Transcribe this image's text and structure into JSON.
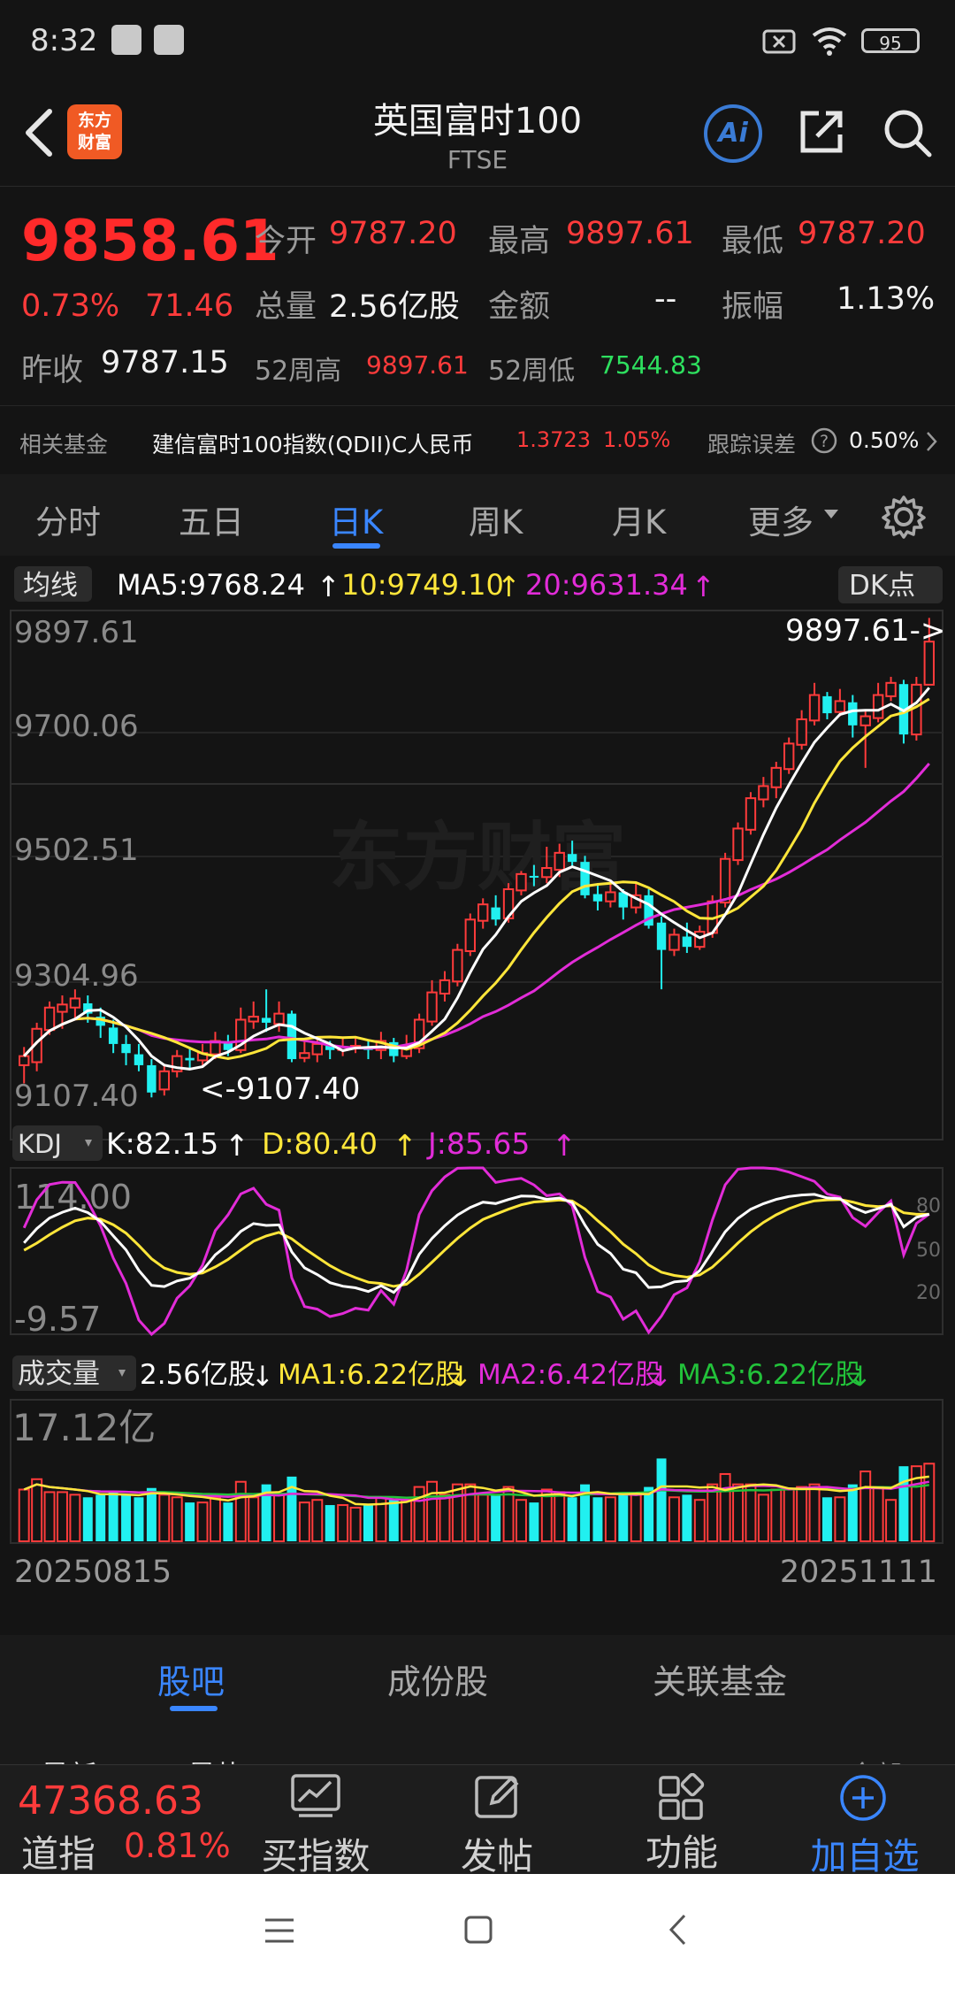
{
  "status_bar": {
    "time": "8:32",
    "battery": "95"
  },
  "header": {
    "logo_text": "东方财富",
    "title": "英国富时100",
    "subtitle": "FTSE",
    "ai_label": "Ai"
  },
  "quote": {
    "last_price": "9858.61",
    "change_pct": "0.73%",
    "change": "71.46",
    "open_label": "今开",
    "open": "9787.20",
    "high_label": "最高",
    "high": "9897.61",
    "low_label": "最低",
    "low": "9787.20",
    "volume_label": "总量",
    "volume": "2.56亿股",
    "amount_label": "金额",
    "amount": "--",
    "amplitude_label": "振幅",
    "amplitude": "1.13%",
    "prev_close_label": "昨收",
    "prev_close": "9787.15",
    "high52_label": "52周高",
    "high52": "9897.61",
    "low52_label": "52周低",
    "low52": "7544.83"
  },
  "related_fund": {
    "label": "相关基金",
    "name": "建信富时100指数(QDII)C人民币",
    "price": "1.3723",
    "pct": "1.05%",
    "error_label": "跟踪误差",
    "error_value": "0.50%"
  },
  "period_tabs": [
    "分时",
    "五日",
    "日K",
    "周K",
    "月K",
    "更多"
  ],
  "active_period": "日K",
  "chart_data": {
    "type": "candlestick",
    "ma_label": "均线",
    "ma5_text": "MA5:9768.24",
    "ma10_text": "10:9749.10",
    "ma20_text": "20:9631.34",
    "dk_label": "DK点",
    "y_ticks": [
      "9897.61",
      "9700.06",
      "9502.51",
      "9304.96",
      "9107.40"
    ],
    "ylim": [
      9107.4,
      9897.61
    ],
    "max_annotation": "9897.61->",
    "min_annotation": "<-9107.40",
    "watermark": "东方财富",
    "candles": [
      [
        9160,
        9175,
        9130,
        9190
      ],
      [
        9165,
        9220,
        9150,
        9230
      ],
      [
        9218,
        9255,
        9210,
        9265
      ],
      [
        9248,
        9260,
        9220,
        9275
      ],
      [
        9255,
        9270,
        9235,
        9285
      ],
      [
        9262,
        9245,
        9230,
        9275
      ],
      [
        9240,
        9225,
        9205,
        9255
      ],
      [
        9222,
        9195,
        9180,
        9235
      ],
      [
        9195,
        9180,
        9160,
        9210
      ],
      [
        9178,
        9160,
        9150,
        9195
      ],
      [
        9160,
        9115,
        9107,
        9170
      ],
      [
        9120,
        9150,
        9110,
        9160
      ],
      [
        9150,
        9175,
        9140,
        9185
      ],
      [
        9172,
        9168,
        9155,
        9190
      ],
      [
        9168,
        9180,
        9160,
        9195
      ],
      [
        9178,
        9200,
        9170,
        9215
      ],
      [
        9198,
        9185,
        9175,
        9210
      ],
      [
        9185,
        9235,
        9180,
        9255
      ],
      [
        9232,
        9240,
        9220,
        9265
      ],
      [
        9238,
        9230,
        9215,
        9285
      ],
      [
        9228,
        9245,
        9215,
        9265
      ],
      [
        9245,
        9170,
        9165,
        9250
      ],
      [
        9172,
        9180,
        9165,
        9200
      ],
      [
        9178,
        9195,
        9165,
        9205
      ],
      [
        9192,
        9185,
        9170,
        9200
      ],
      [
        9185,
        9190,
        9175,
        9205
      ],
      [
        9188,
        9192,
        9180,
        9205
      ],
      [
        9190,
        9185,
        9170,
        9200
      ],
      [
        9185,
        9200,
        9170,
        9215
      ],
      [
        9198,
        9175,
        9165,
        9205
      ],
      [
        9175,
        9190,
        9170,
        9210
      ],
      [
        9188,
        9235,
        9180,
        9245
      ],
      [
        9232,
        9280,
        9225,
        9300
      ],
      [
        9278,
        9300,
        9265,
        9315
      ],
      [
        9298,
        9350,
        9290,
        9360
      ],
      [
        9348,
        9400,
        9340,
        9410
      ],
      [
        9398,
        9425,
        9385,
        9435
      ],
      [
        9420,
        9400,
        9390,
        9440
      ],
      [
        9402,
        9450,
        9395,
        9460
      ],
      [
        9448,
        9475,
        9440,
        9480
      ],
      [
        9472,
        9470,
        9455,
        9490
      ],
      [
        9470,
        9485,
        9460,
        9520
      ],
      [
        9482,
        9510,
        9470,
        9525
      ],
      [
        9508,
        9495,
        9485,
        9530
      ],
      [
        9495,
        9440,
        9435,
        9505
      ],
      [
        9442,
        9430,
        9415,
        9460
      ],
      [
        9430,
        9445,
        9420,
        9465
      ],
      [
        9445,
        9420,
        9400,
        9450
      ],
      [
        9420,
        9440,
        9410,
        9460
      ],
      [
        9440,
        9390,
        9385,
        9450
      ],
      [
        9395,
        9350,
        9285,
        9405
      ],
      [
        9350,
        9375,
        9340,
        9385
      ],
      [
        9372,
        9355,
        9345,
        9395
      ],
      [
        9355,
        9380,
        9350,
        9390
      ],
      [
        9378,
        9430,
        9370,
        9440
      ],
      [
        9428,
        9500,
        9420,
        9510
      ],
      [
        9498,
        9550,
        9490,
        9560
      ],
      [
        9548,
        9600,
        9540,
        9610
      ],
      [
        9598,
        9620,
        9585,
        9635
      ],
      [
        9618,
        9650,
        9600,
        9660
      ],
      [
        9648,
        9690,
        9640,
        9700
      ],
      [
        9688,
        9730,
        9680,
        9745
      ],
      [
        9728,
        9770,
        9720,
        9790
      ],
      [
        9768,
        9740,
        9730,
        9775
      ],
      [
        9742,
        9760,
        9735,
        9780
      ],
      [
        9758,
        9720,
        9700,
        9770
      ],
      [
        9720,
        9735,
        9650,
        9745
      ],
      [
        9732,
        9770,
        9725,
        9790
      ],
      [
        9768,
        9790,
        9760,
        9800
      ],
      [
        9788,
        9705,
        9690,
        9795
      ],
      [
        9705,
        9787,
        9695,
        9800
      ],
      [
        9787,
        9858,
        9787,
        9897
      ]
    ],
    "kdj": {
      "label": "KDJ",
      "k_text": "K:82.15",
      "d_text": "D:80.40",
      "j_text": "J:85.65",
      "y_ticks": [
        "114.00",
        "-9.57"
      ],
      "levels": [
        "80",
        "50",
        "20"
      ]
    },
    "volume": {
      "label": "成交量",
      "value_text": "2.56亿股",
      "ma1_text": "MA1:6.22亿股",
      "ma2_text": "MA2:6.42亿股",
      "ma3_text": "MA3:6.22亿股",
      "max_text": "17.12亿",
      "start_date": "20250815",
      "end_date": "20251111"
    }
  },
  "bottom_tabs": [
    "股吧",
    "成份股",
    "关联基金"
  ],
  "active_bottom_tab": "股吧",
  "sub_tabs": [
    "最新",
    "最热",
    "全部"
  ],
  "toolbar": {
    "ticker_price": "47368.63",
    "ticker_name": "道指",
    "ticker_pct": "0.81%",
    "buy_label": "买指数",
    "post_label": "发帖",
    "func_label": "功能",
    "add_label": "加自选"
  },
  "colors": {
    "up": "#ff3b3b",
    "down": "#21f0f0",
    "accent": "#3a86ff",
    "ma5": "#ffffff",
    "ma10": "#ffe63a",
    "ma20": "#e22cd8"
  }
}
